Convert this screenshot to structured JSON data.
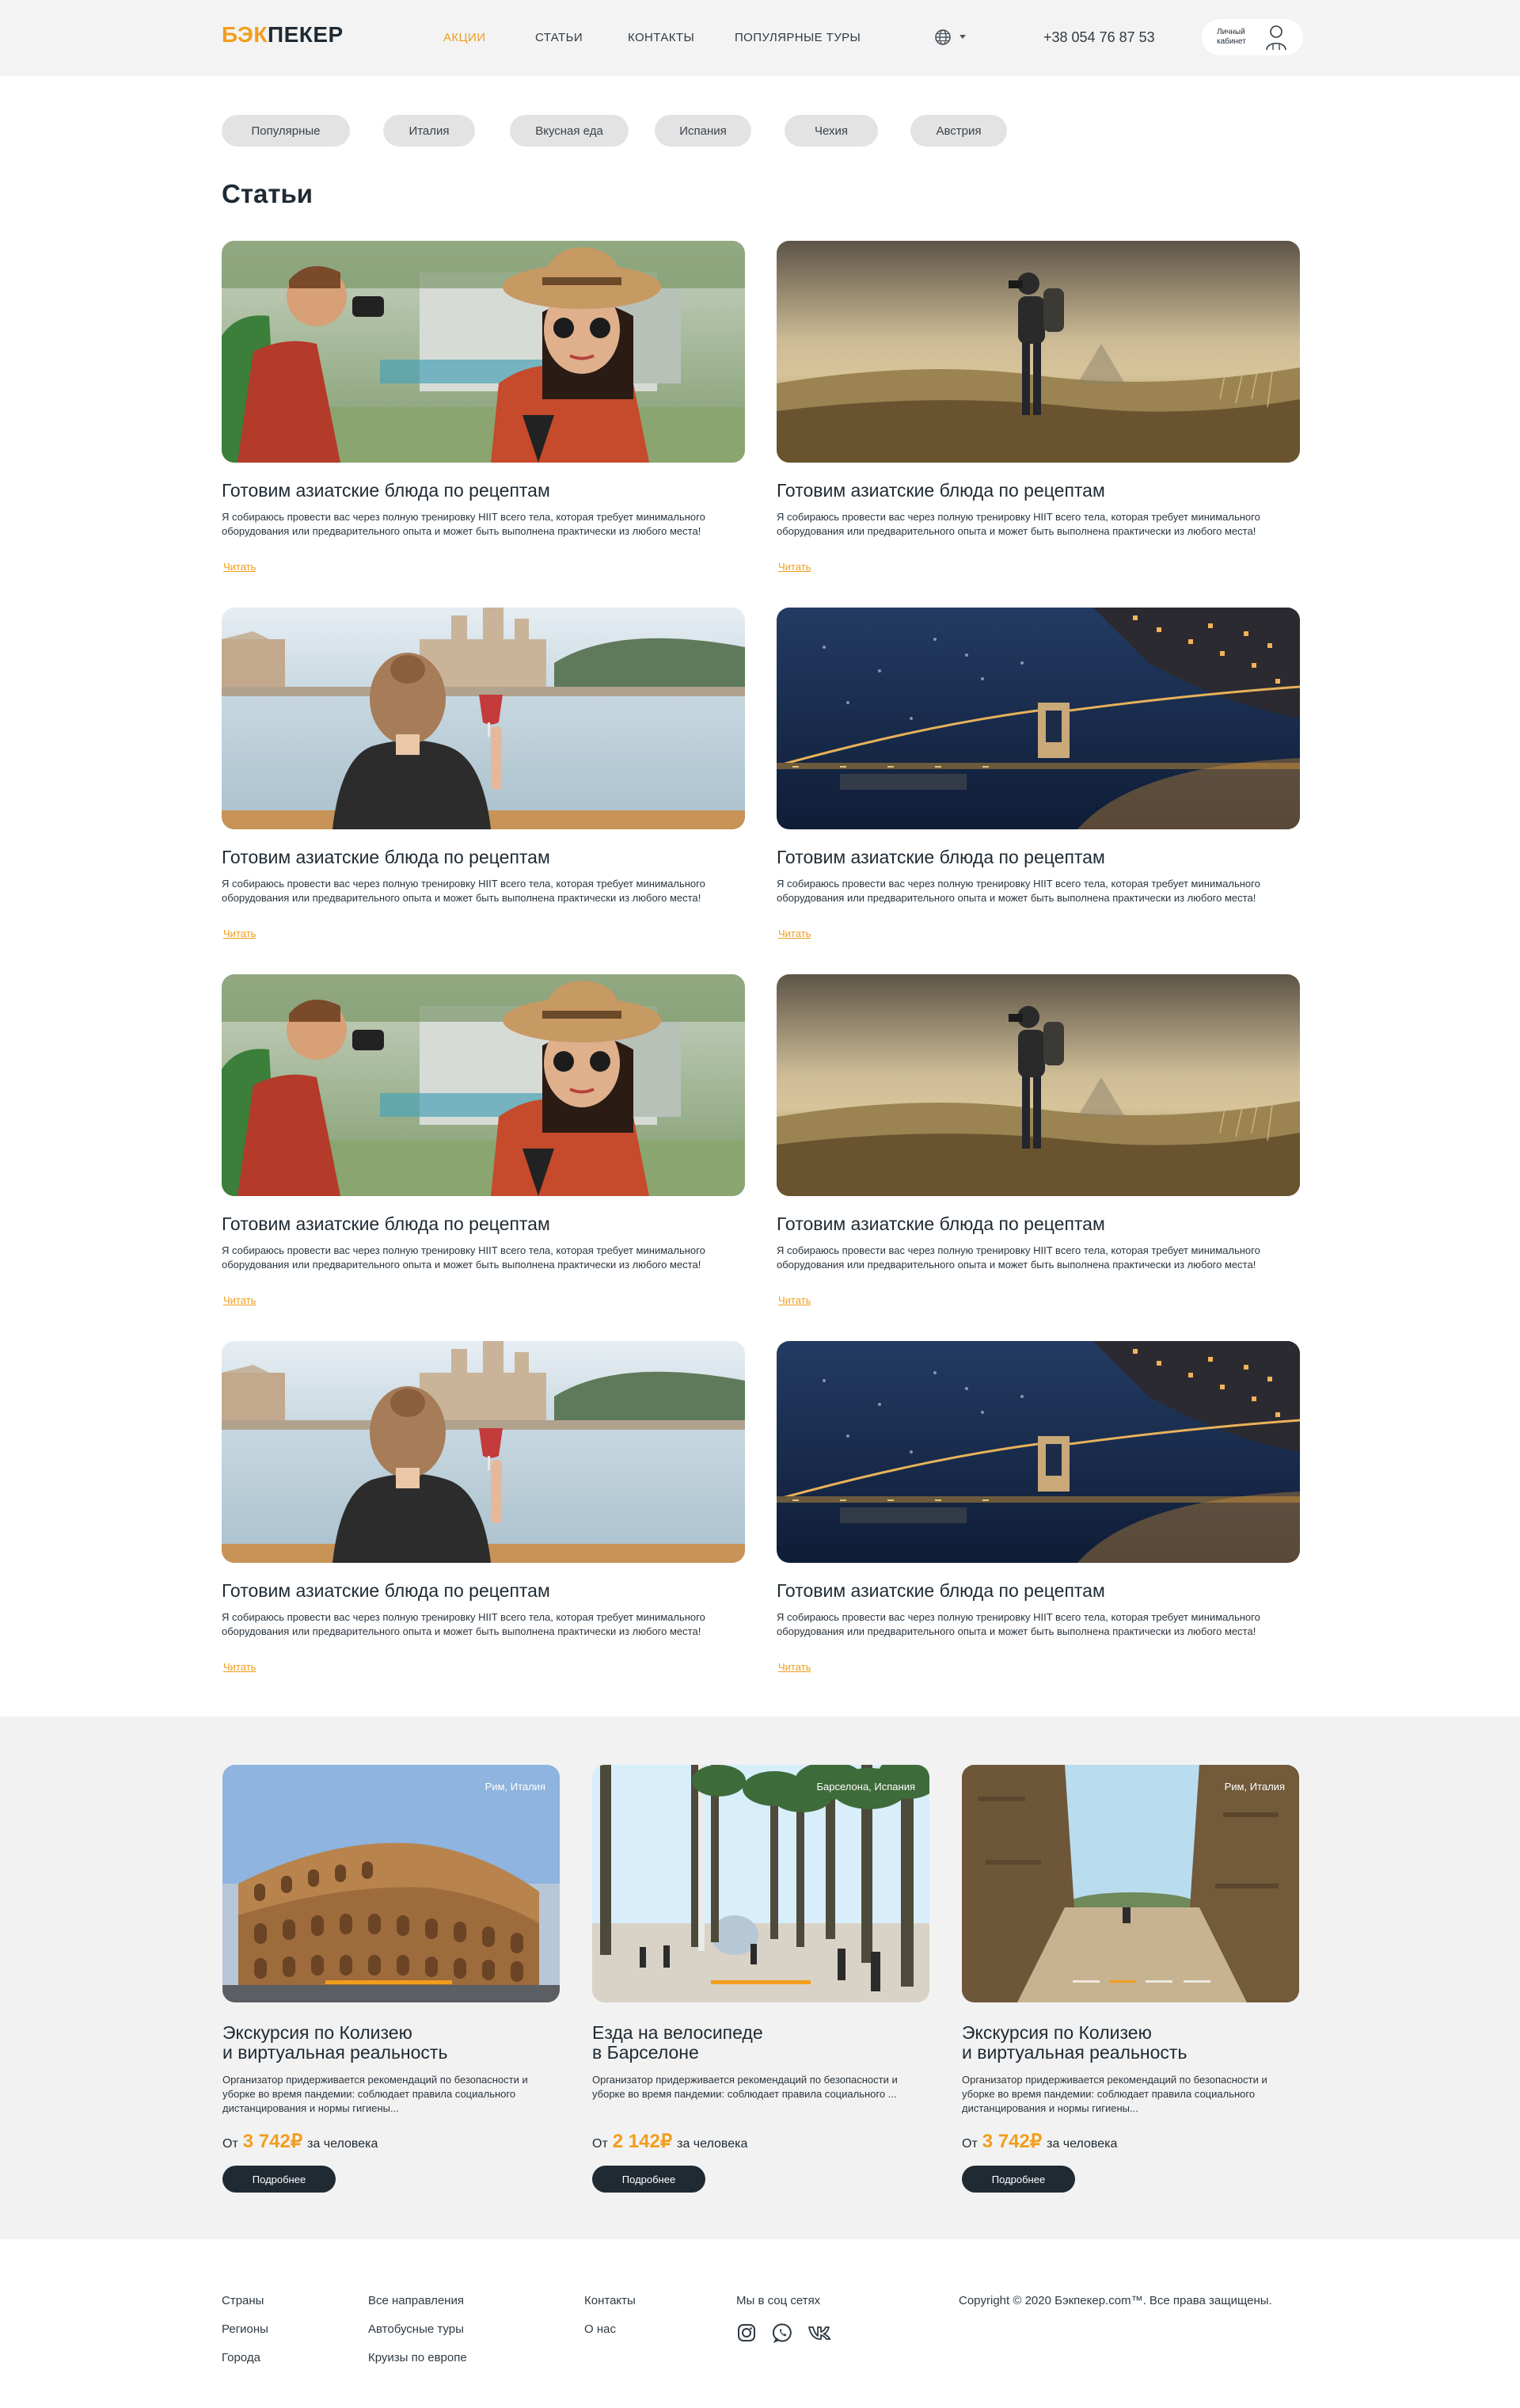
{
  "header": {
    "logo_part1": "БЭК",
    "logo_part2": "ПЕКЕР",
    "nav": [
      "АКЦИИ",
      "СТАТЬИ",
      "КОНТАКТЫ",
      "ПОПУЛЯРНЫЕ ТУРЫ"
    ],
    "active_nav": "АКЦИИ",
    "language_icon": "globe-icon",
    "phone": "+38 054 76 87 53",
    "cabinet": "Личный кабинет",
    "cabinet_icon": "user-icon"
  },
  "filters": [
    "Популярные",
    "Италия",
    "Вкусная еда",
    "Испания",
    "Чехия",
    "Австрия"
  ],
  "page_title": "Статьи",
  "articles": [
    {
      "title": "Готовим азиатские блюда по рецептам",
      "text": "Я собираюсь провести вас через полную тренировку HIIT всего тела, которая требует минимального оборудования или предварительного опыта и может быть выполнена практически из любого места!",
      "link": "Читать"
    },
    {
      "title": "Готовим азиатские блюда по рецептам",
      "text": "Я собираюсь провести вас через полную тренировку HIIT всего тела, которая требует минимального оборудования или предварительного опыта и может быть выполнена практически из любого места!",
      "link": "Читать"
    },
    {
      "title": "Готовим азиатские блюда по рецептам",
      "text": "Я собираюсь провести вас через полную тренировку HIIT всего тела, которая требует минимального оборудования или предварительного опыта и может быть выполнена практически из любого места!",
      "link": "Читать"
    },
    {
      "title": "Готовим азиатские блюда по рецептам",
      "text": "Я собираюсь провести вас через полную тренировку HIIT всего тела, которая требует минимального оборудования или предварительного опыта и может быть выполнена практически из любого места!",
      "link": "Читать"
    },
    {
      "title": "Готовим азиатские блюда по рецептам",
      "text": "Я собираюсь провести вас через полную тренировку HIIT всего тела, которая требует минимального оборудования или предварительного опыта и может быть выполнена практически из любого места!",
      "link": "Читать"
    },
    {
      "title": "Готовим азиатские блюда по рецептам",
      "text": "Я собираюсь провести вас через полную тренировку HIIT всего тела, которая требует минимального оборудования или предварительного опыта и может быть выполнена практически из любого места!",
      "link": "Читать"
    },
    {
      "title": "Готовим азиатские блюда по рецептам",
      "text": "Я собираюсь провести вас через полную тренировку HIIT всего тела, которая требует минимального оборудования или предварительного опыта и может быть выполнена практически из любого места!",
      "link": "Читать"
    },
    {
      "title": "Готовим азиатские блюда по рецептам",
      "text": "Я собираюсь провести вас через полную тренировку HIIT всего тела, которая требует минимального оборудования или предварительного опыта и может быть выполнена практически из любого места!",
      "link": "Читать"
    }
  ],
  "tours": [
    {
      "location": "Рим, Италия",
      "title_line1": "Экскурсия по Колизею",
      "title_line2": "и виртуальная реальность",
      "text": "Организатор придерживается рекомендаций по безопасности и уборке во время пандемии: соблюдает правила социального дистанцирования и нормы гигиены...",
      "price_prefix": "От",
      "price": "3 742₽",
      "price_suffix": "за человека",
      "button": "Подробнее"
    },
    {
      "location": "Барселона, Испания",
      "title_line1": "Езда на велосипеде",
      "title_line2": "в Барселоне",
      "text": "Организатор придерживается рекомендаций по безопасности и уборке во время пандемии: соблюдает правила социального ...",
      "price_prefix": "От",
      "price": "2 142₽",
      "price_suffix": "за человека",
      "button": "Подробнее"
    },
    {
      "location": "Рим, Италия",
      "title_line1": "Экскурсия по Колизею",
      "title_line2": "и виртуальная реальность",
      "text": "Организатор придерживается рекомендаций по безопасности и уборке во время пандемии: соблюдает правила социального дистанцирования и нормы гигиены...",
      "price_prefix": "От",
      "price": "3 742₽",
      "price_suffix": "за человека",
      "button": "Подробнее"
    }
  ],
  "footer": {
    "col1": [
      "Страны",
      "Регионы",
      "Города"
    ],
    "col2": [
      "Все направления",
      "Автобусные туры",
      "Круизы по европе"
    ],
    "col3": [
      "Контакты",
      "О нас"
    ],
    "social_title": "Мы в соц сетях",
    "social_icons": [
      "instagram-icon",
      "whatsapp-icon",
      "vk-icon"
    ],
    "copyright": "Copyright © 2020 Бэкпекер.com™. Все права защищены."
  },
  "colors": {
    "accent": "#f29d1d",
    "dark": "#1f2a33",
    "header_bg": "#f3f3f3",
    "chip_bg": "#e3e3e3",
    "section_bg": "#f2f2f2"
  }
}
